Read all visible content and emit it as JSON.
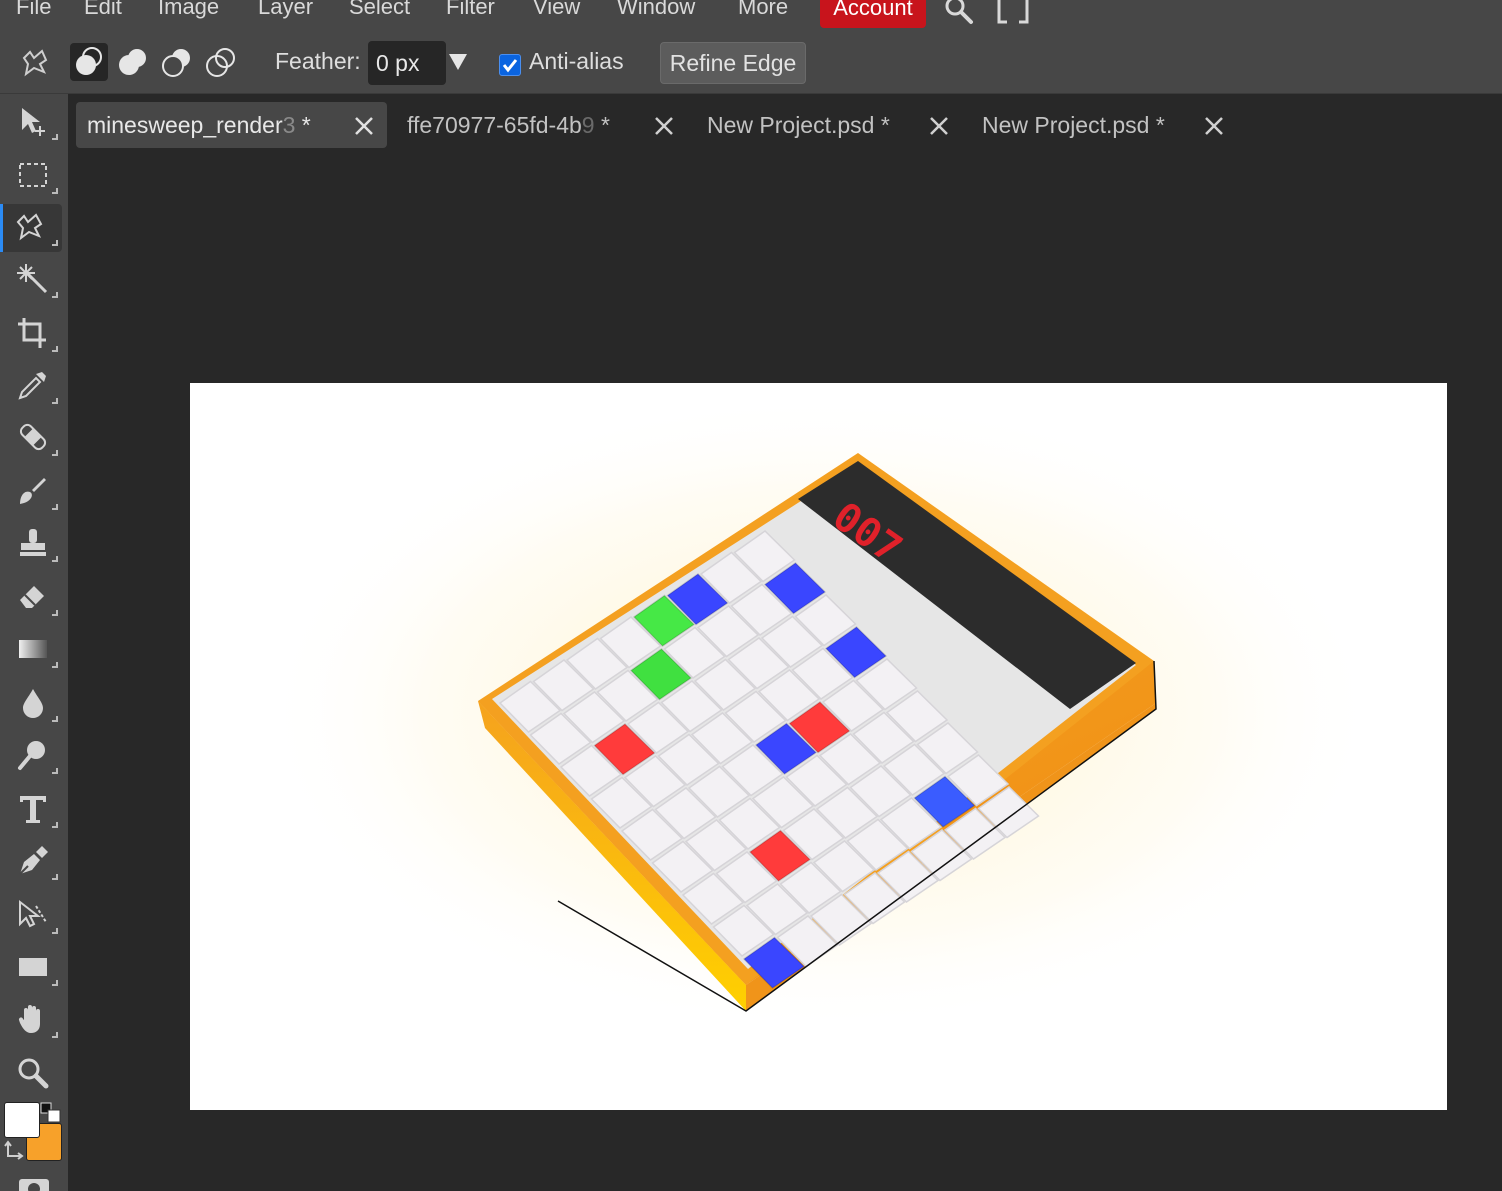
{
  "menu": {
    "items": [
      "File",
      "Edit",
      "Image",
      "Layer",
      "Select",
      "Filter",
      "View",
      "Window",
      "More"
    ],
    "account": "Account"
  },
  "options": {
    "feather_label": "Feather:",
    "feather_value": "0 px",
    "antialias_label": "Anti-alias",
    "antialias_checked": true,
    "refine_edge": "Refine Edge"
  },
  "tabs": [
    {
      "name": "minesweep_render",
      "faded": "3",
      "suffix": " *",
      "active": true
    },
    {
      "name": "ffe70977-65fd-4b",
      "faded": "9",
      "suffix": " *",
      "active": false
    },
    {
      "name": "New Project.psd",
      "faded": "",
      "suffix": " *",
      "active": false
    },
    {
      "name": "New Project.psd",
      "faded": "",
      "suffix": " *",
      "active": false
    }
  ],
  "tools": [
    "move-tool",
    "marquee-tool",
    "lasso-tool",
    "magic-wand-tool",
    "crop-tool",
    "eyedropper-tool",
    "healing-tool",
    "brush-tool",
    "stamp-tool",
    "eraser-tool",
    "gradient-tool",
    "blur-tool",
    "dodge-tool",
    "type-tool",
    "pen-tool",
    "path-select-tool",
    "shape-tool",
    "hand-tool",
    "zoom-tool"
  ],
  "active_tool": "lasso-tool",
  "colors": {
    "accent": "#2b8bf5",
    "account": "#c8141c",
    "foreground": "#ffffff",
    "background": "#f7a12a"
  },
  "canvas": {
    "counter_text": "007"
  }
}
